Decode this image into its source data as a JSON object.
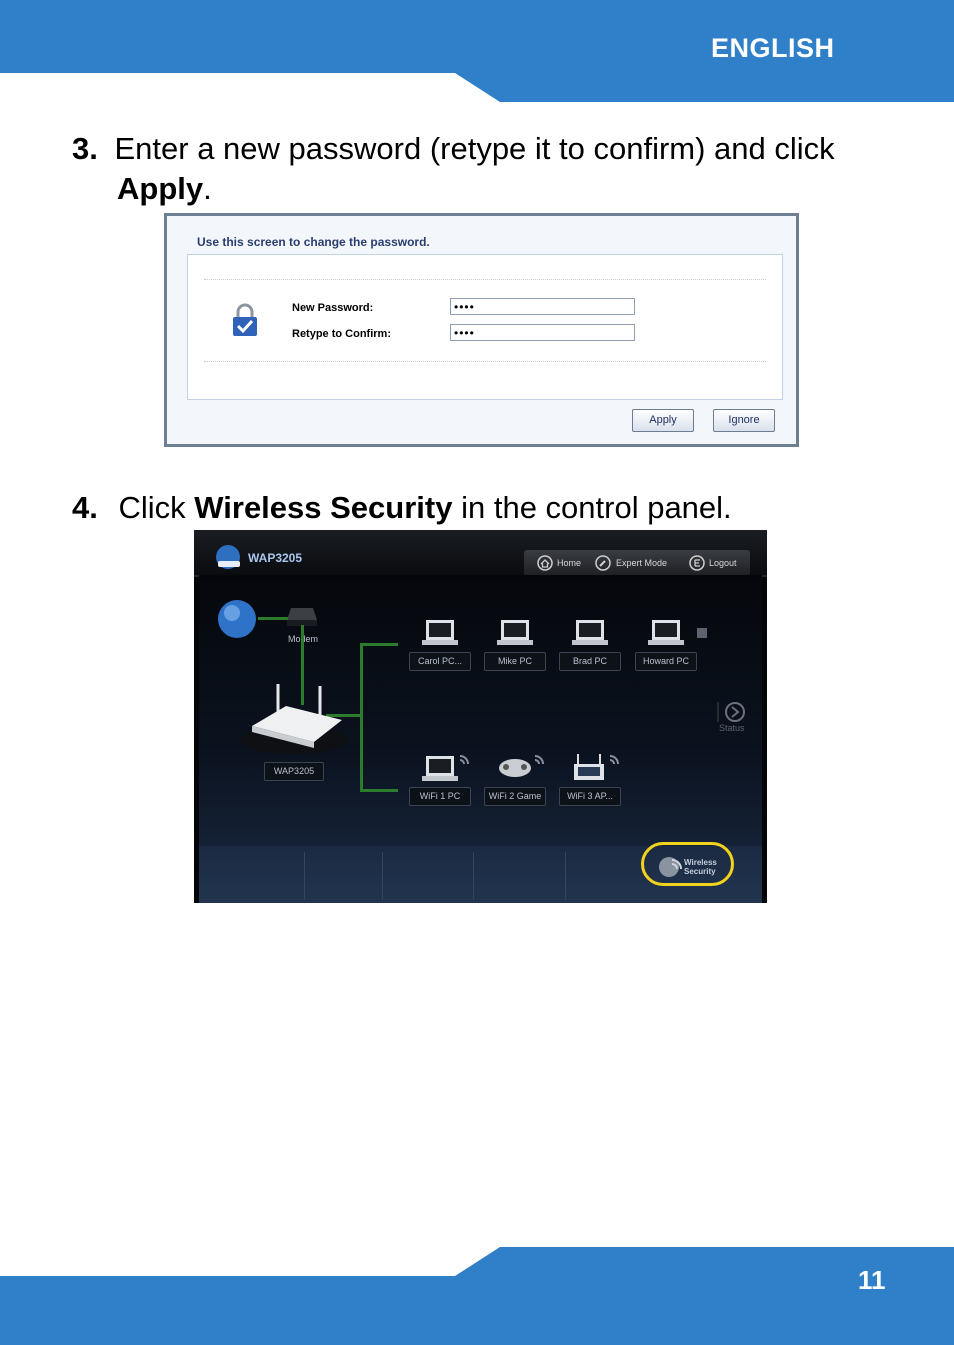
{
  "header": {
    "language": "ENGLISH"
  },
  "footer": {
    "page_number": "11"
  },
  "colors": {
    "brand_blue": "#2f7fc9",
    "highlight_ring": "#f2d21c",
    "link_line": "#2b7d2b"
  },
  "step3": {
    "number": "3.",
    "text_before": "Enter a new password (retype it to confirm) and click",
    "bold": "Apply",
    "text_after": "."
  },
  "password_screen": {
    "title": "Use this screen to change the password.",
    "new_password_label": "New Password:",
    "new_password_value": "••••",
    "retype_label": "Retype to Confirm:",
    "retype_value": "••••",
    "apply_button": "Apply",
    "ignore_button": "Ignore",
    "icon": "lock-icon"
  },
  "step4": {
    "number": "4.",
    "text_before": "Click",
    "bold": "Wireless Security",
    "text_after": "in the control panel."
  },
  "control_panel": {
    "brand": "WAP3205",
    "nav": {
      "home": "Home",
      "expert": "Expert Mode",
      "logout": "Logout"
    },
    "modem_label": "Modem",
    "router_label": "WAP3205",
    "wired_clients": [
      "Carol PC...",
      "Mike PC",
      "Brad PC",
      "Howard PC"
    ],
    "wireless_clients": [
      "WiFi 1 PC",
      "WiFi 2 Game",
      "WiFi 3 AP..."
    ],
    "status_label": "Status",
    "wireless_security_line1": "Wireless",
    "wireless_security_line2": "Security"
  }
}
